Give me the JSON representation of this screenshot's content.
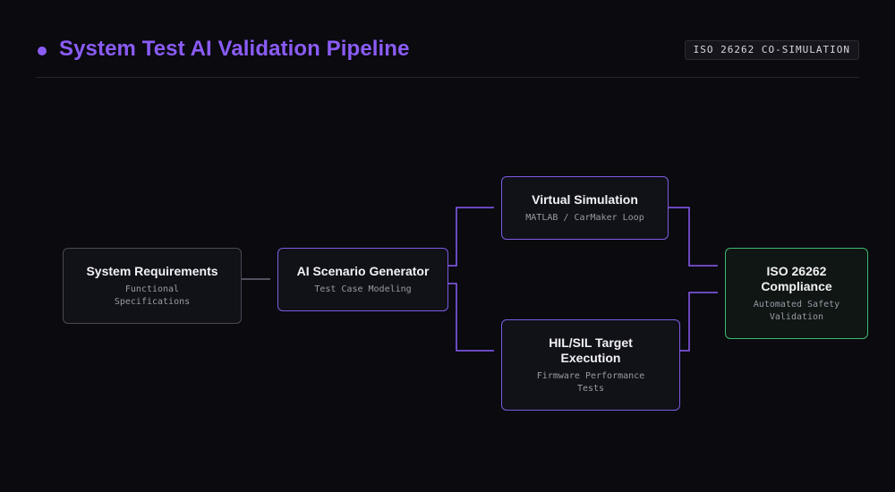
{
  "header": {
    "title": "System Test AI Validation Pipeline",
    "badge": "ISO 26262 CO-SIMULATION"
  },
  "colors": {
    "background": "#0a0a0f",
    "accent": "#8b5cf6",
    "node_border_default": "#4a4a55",
    "node_border_active": "#7c5ce0",
    "node_border_success": "#3fb871"
  },
  "nodes": {
    "requirements": {
      "title": "System Requirements",
      "subtitle": "Functional\nSpecifications"
    },
    "ai_generator": {
      "title": "AI Scenario Generator",
      "subtitle": "Test Case Modeling"
    },
    "virtual_sim": {
      "title": "Virtual Simulation",
      "subtitle": "MATLAB / CarMaker Loop"
    },
    "hil_sil": {
      "title": "HIL/SIL Target\nExecution",
      "subtitle": "Firmware Performance\nTests"
    },
    "iso_compliance": {
      "title": "ISO 26262\nCompliance",
      "subtitle": "Automated Safety\nValidation"
    }
  },
  "edges": [
    {
      "from": "requirements",
      "to": "ai_generator"
    },
    {
      "from": "ai_generator",
      "to": "virtual_sim"
    },
    {
      "from": "ai_generator",
      "to": "hil_sil"
    },
    {
      "from": "virtual_sim",
      "to": "iso_compliance"
    },
    {
      "from": "hil_sil",
      "to": "iso_compliance"
    }
  ]
}
